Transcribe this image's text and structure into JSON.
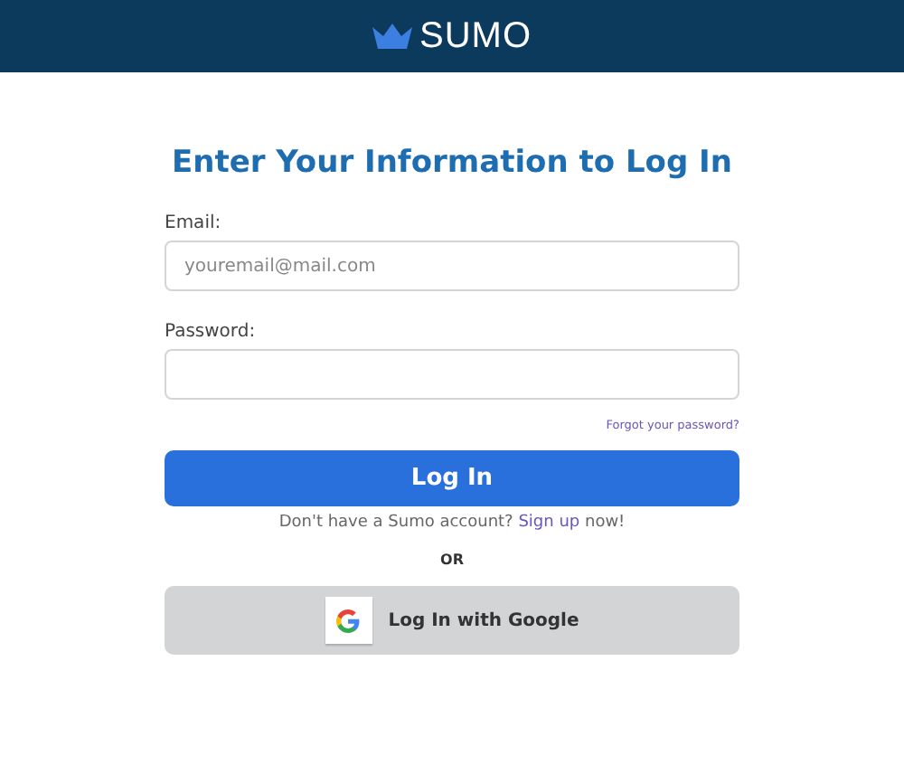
{
  "header": {
    "logo_text": "SUMO"
  },
  "title": "Enter Your Information to Log In",
  "email": {
    "label": "Email:",
    "placeholder": "youremail@mail.com"
  },
  "password": {
    "label": "Password:"
  },
  "forgot_link": "Forgot your password?",
  "login_button": "Log In",
  "signup": {
    "before": "Don't have a Sumo account? ",
    "link": "Sign up",
    "after": " now!"
  },
  "divider_text": "OR",
  "google_button": "Log In with Google"
}
